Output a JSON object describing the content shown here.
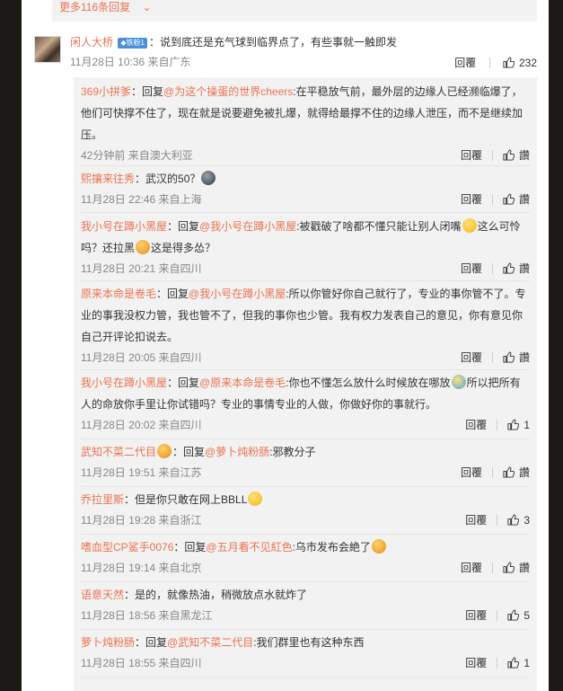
{
  "more_replies": {
    "label": "更多116条回复",
    "chevron": "chevron-down-icon"
  },
  "main_comment": {
    "user": "闲人大桥",
    "badge": "铁粉1",
    "text": "：说到底还是充气球到临界点了，有些事就一触即发",
    "time": "11月28日 10:36",
    "location": "来自广东",
    "reply_label": "回覆",
    "likes": "232"
  },
  "replies": [
    {
      "user": "369小拼爹",
      "prefix": "：回复",
      "target": "@为这个操蛋的世界cheers",
      "text": ":在平稳放气前，最外层的边缘人已经濒临爆了，他们可快撑不住了，现在就是说要避免被扎爆，就得给最撑不住的边缘人泄压，而不是继续加压。",
      "time": "42分钟前",
      "location": "来自澳大利亚",
      "reply_label": "回覆",
      "likes": "讚"
    },
    {
      "user": "熙攘来往秀",
      "prefix": "",
      "target": "",
      "text": "：武汉的50？",
      "time": "11月28日 22:46",
      "location": "来自上海",
      "reply_label": "回覆",
      "likes": "讚"
    },
    {
      "user": "我小号在蹲小黑屋",
      "prefix": "：回复",
      "target": "@我小号在蹲小黑屋",
      "text": ":被戳破了啥都不懂只能让别人闭嘴",
      "text2": "这么可怜吗？还拉黑",
      "text3": "这是得多怂？",
      "time": "11月28日 20:21",
      "location": "来自四川",
      "reply_label": "回覆",
      "likes": "讚"
    },
    {
      "user": "原来本命是卷毛",
      "prefix": "：回复",
      "target": "@我小号在蹲小黑屋",
      "text": ":所以你管好你自己就行了，专业的事你管不了。专业的事我没权力管，我也管不了，但我的事你也少管。我有权力发表自己的意见，你有意见你自己开评论扣说去。",
      "time": "11月28日 20:05",
      "location": "来自四川",
      "reply_label": "回覆",
      "likes": "讚"
    },
    {
      "user": "我小号在蹲小黑屋",
      "prefix": "：回复",
      "target": "@原来本命是卷毛",
      "text": ":你也不懂怎么放什么时候放在哪放",
      "text2": "所以把所有人的命放你手里让你试错吗？专业的事情专业的人做，你做好你的事就行。",
      "time": "11月28日 20:02",
      "location": "来自四川",
      "reply_label": "回覆",
      "likes": "1"
    },
    {
      "user": "武知不菜二代目",
      "prefix": "：回复",
      "target": "@萝卜炖粉肠",
      "text": ":邪教分子",
      "time": "11月28日 19:51",
      "location": "来自江苏",
      "reply_label": "回覆",
      "likes": "讚"
    },
    {
      "user": "乔拉里斯",
      "prefix": "",
      "target": "",
      "text": "：但是你只敢在网上BBLL",
      "time": "11月28日 19:28",
      "location": "来自浙江",
      "reply_label": "回覆",
      "likes": "3"
    },
    {
      "user": "嗜血型CP鲨手0076",
      "prefix": "：回复",
      "target": "@五月看不见紅色",
      "text": ":乌市发布会絶了",
      "time": "11月28日 19:14",
      "location": "来自北京",
      "reply_label": "回覆",
      "likes": "讚"
    },
    {
      "user": "语意天然",
      "prefix": "",
      "target": "",
      "text": "：是的，就像热油，稍微放点水就炸了",
      "time": "11月28日 18:56",
      "location": "来自黑龙江",
      "reply_label": "回覆",
      "likes": "5"
    },
    {
      "user": "萝卜炖粉肠",
      "prefix": "：回复",
      "target": "@武知不菜二代目",
      "text": ":我们群里也有这种东西",
      "time": "11月28日 18:55",
      "location": "来自四川",
      "reply_label": "回覆",
      "likes": "1"
    }
  ],
  "colors": {
    "link": "#eb7350",
    "page_bg": "#1c1916",
    "reply_bg": "#f2f2f2"
  },
  "icons": [
    "chevron-down-icon",
    "thumbs-up-icon",
    "emoji-icon",
    "verified-badge-icon"
  ]
}
